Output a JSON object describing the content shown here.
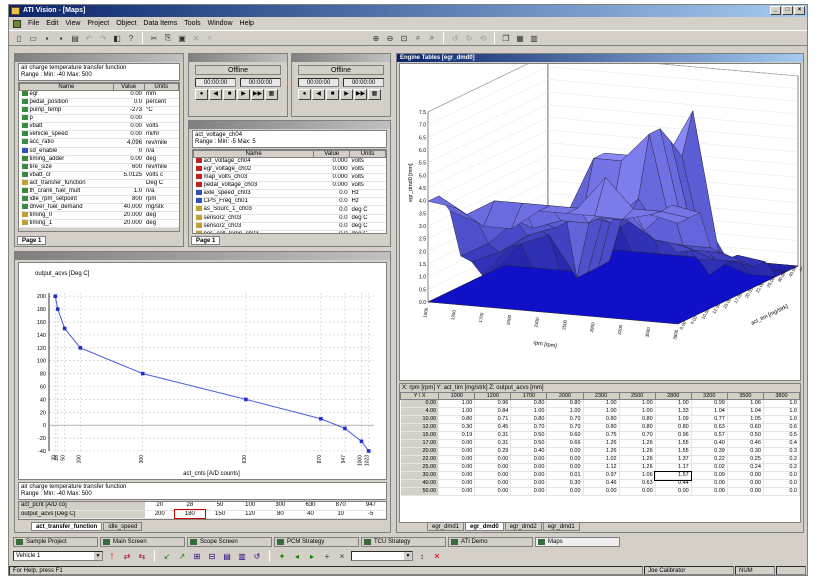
{
  "app": {
    "title": "ATI Vision - [Maps]"
  },
  "menu": [
    "File",
    "Edit",
    "View",
    "Project",
    "Object",
    "Data Items",
    "Tools",
    "Window",
    "Help"
  ],
  "toolbar": {
    "icons": [
      "new-icon",
      "open-icon",
      "save-icon",
      "save-all-icon",
      "print-icon",
      "cut-icon",
      "copy-icon",
      "paste-icon",
      "undo-icon",
      "redo-icon",
      "zoom-in-icon",
      "zoom-out-icon",
      "zoom-fit-icon",
      "zoom-window-icon",
      "rotate-icon",
      "settings-icon"
    ]
  },
  "charge_panel": {
    "function": "air charge temperature transfer function",
    "range": "Range : Min: -40  Max: 500",
    "headers": [
      "Name",
      "Value",
      "Units"
    ],
    "rows": [
      [
        "egr",
        "0.00",
        "mm"
      ],
      [
        "pedal_position",
        "0.0",
        "percent"
      ],
      [
        "pump_temp",
        "-273",
        "°C"
      ],
      [
        "p",
        "0.00",
        ""
      ],
      [
        "vbatt",
        "0.00",
        "volts"
      ],
      [
        "vehicle_speed",
        "0.00",
        "mi/hr"
      ],
      [
        "acc_ratio",
        "4,096",
        "rev/mile"
      ],
      [
        "sd_enable",
        "0",
        "n/a"
      ],
      [
        "timing_adder",
        "0.00",
        "deg"
      ],
      [
        "tire_size",
        "600",
        "rev/mile"
      ],
      [
        "vbatt_cr",
        "5.0125",
        "volts c"
      ],
      [
        "act_transfer_function",
        "",
        "Deg C"
      ],
      [
        "th_crank_fuel_mult",
        "1.0",
        "n/a"
      ],
      [
        "idle_rpm_setpoint",
        "800",
        "rpm"
      ],
      [
        "driver_fuel_demand",
        "40,000",
        "mg/stk"
      ],
      [
        "timing_0",
        "20.000",
        "deg"
      ],
      [
        "timing_1",
        "20.000",
        "deg"
      ]
    ],
    "tab": "Page 1"
  },
  "timer_panel_1": {
    "status": "Offline",
    "t1": "00:00:00",
    "t2": "00:00:00"
  },
  "timer_panel_2": {
    "status": "Offline",
    "t1": "00:00:00",
    "t2": "00:00:00"
  },
  "voltage_panel": {
    "function": "act_voltage_ch04",
    "range": "Range : Min: -5  Max: 5",
    "headers": [
      "Name",
      "Value",
      "Units"
    ],
    "rows": [
      [
        "act_voltage_ch04",
        "0.000",
        "volts"
      ],
      [
        "egr_voltage_ch02",
        "0.000",
        "volts"
      ],
      [
        "map_volts_ch03",
        "0.000",
        "volts"
      ],
      [
        "pedal_voltage_ch03",
        "0.000",
        "volts"
      ],
      [
        "axle_speed_ch03",
        "0.0",
        "Hz"
      ],
      [
        "CPS_Freq_ch01",
        "0.0",
        "Hz"
      ],
      [
        "as_Sourc_1_ch03",
        "0.0",
        "deg C"
      ],
      [
        "sensor2_ch03",
        "0.0",
        "deg C"
      ],
      [
        "sensor2_ch03",
        "0.0",
        "deg C"
      ],
      [
        "pos_cell_temp_ch03",
        "0.0",
        "deg C"
      ]
    ],
    "tab": "Page 1"
  },
  "curve_panel": {
    "chart_data": {
      "type": "line",
      "title": "output_acvs [Deg C]",
      "xlabel": "act_cnts [A/D counts]",
      "ylabel": "",
      "x": [
        20,
        28,
        50,
        100,
        300,
        630,
        870,
        947,
        1000,
        1023
      ],
      "y": [
        200,
        180,
        150,
        120,
        80,
        40,
        10,
        -5,
        -25,
        -40
      ],
      "yticks": [
        200,
        180,
        160,
        140,
        120,
        100,
        80,
        60,
        40,
        20,
        0,
        -20,
        -40
      ],
      "xticks": [
        "20",
        "28",
        "50",
        "100",
        "300",
        "630",
        "870",
        "947",
        "1000",
        "1023"
      ],
      "xlim": [
        0,
        1040
      ],
      "ylim": [
        -40,
        205
      ],
      "grid": true
    },
    "info_function": "air charge temperature transfer function",
    "info_range": "Range : Min: -40  Max: 500",
    "row_labels": [
      "act_pcnt [A/D co]",
      "output_acvs [Deg C]"
    ],
    "row1": [
      "20",
      "28",
      "50",
      "100",
      "300",
      "630",
      "870",
      "947"
    ],
    "row2": [
      "200",
      "180",
      "150",
      "120",
      "80",
      "40",
      "10",
      "-5"
    ],
    "tabs": [
      "act_transfer_function",
      "idle_speed"
    ]
  },
  "engine_panel": {
    "title": "Engine Tables [egr_dmd0]",
    "z_ticks": [
      "7.5",
      "7.0",
      "6.5",
      "6.0",
      "5.5",
      "5.0",
      "4.5",
      "4.0",
      "3.5",
      "3.0",
      "2.5",
      "2.0",
      "1.5",
      "1.0",
      "0.5",
      "0.0"
    ],
    "z_label": "egr_dmd0 [mm]",
    "x_label": "rpm [rpm]",
    "y_label": "act_tim [mg/strk]",
    "axis_top_left": "act_tim [mg/strk]",
    "axis_top_right": "rpm [rpm]",
    "table_header": "X: rpm [rpm]    Y: act_tim [mg/strk]    Z: output_acvs [mm]",
    "cols": [
      "Y \\ X",
      "1000",
      "1200",
      "1700",
      "2000",
      "2300",
      "2500",
      "2800",
      "3200",
      "3500",
      "3800"
    ],
    "rows": [
      [
        "0.00",
        "1.00",
        "0.96",
        "0.80",
        "0.80",
        "1.00",
        "1.00",
        "1.00",
        "0.99",
        "1.06",
        "1.0"
      ],
      [
        "4.00",
        "1.00",
        "0.84",
        "1.00",
        "1.00",
        "1.00",
        "1.00",
        "1.33",
        "1.04",
        "1.04",
        "1.0"
      ],
      [
        "10.00",
        "0.80",
        "0.71",
        "0.80",
        "0.70",
        "0.80",
        "0.80",
        "1.09",
        "0.77",
        "1.05",
        "1.0"
      ],
      [
        "12.00",
        "0.30",
        "0.45",
        "0.70",
        "0.70",
        "0.80",
        "0.80",
        "0.80",
        "0.63",
        "0.60",
        "0.6"
      ],
      [
        "15.00",
        "0.19",
        "0.31",
        "0.50",
        "0.60",
        "0.75",
        "0.70",
        "0.96",
        "0.57",
        "0.50",
        "0.5"
      ],
      [
        "17.00",
        "0.00",
        "0.31",
        "0.50",
        "0.66",
        "1.26",
        "1.26",
        "1.55",
        "0.40",
        "0.46",
        "0.4"
      ],
      [
        "20.00",
        "0.00",
        "0.29",
        "0.40",
        "0.00",
        "1.26",
        "1.26",
        "1.55",
        "0.39",
        "0.30",
        "0.3"
      ],
      [
        "22.00",
        "0.00",
        "0.00",
        "0.00",
        "0.00",
        "1.02",
        "1.26",
        "1.37",
        "0.22",
        "0.25",
        "0.2"
      ],
      [
        "25.00",
        "0.00",
        "0.00",
        "0.00",
        "0.00",
        "1.12",
        "1.26",
        "1.17",
        "0.02",
        "0.24",
        "0.2"
      ],
      [
        "30.00",
        "0.00",
        "0.00",
        "0.00",
        "0.01",
        "0.97",
        "1.06",
        "1.57",
        "0.09",
        "0.00",
        "0.0"
      ],
      [
        "40.00",
        "0.00",
        "0.00",
        "0.00",
        "0.30",
        "0.46",
        "0.63",
        "0.44",
        "0.00",
        "0.00",
        "0.0"
      ],
      [
        "50.00",
        "0.00",
        "0.00",
        "0.00",
        "0.00",
        "0.00",
        "0.00",
        "0.00",
        "0.00",
        "0.00",
        "0.0"
      ]
    ],
    "tabs": [
      "egr_dmd1",
      "egr_dmd0",
      "egr_dmd2",
      "egr_dmd1"
    ]
  },
  "tasks": [
    "Sample Project",
    "Main Screen",
    "Scope Screen",
    "PCM Strategy",
    "TCU Strategy",
    "ATI Demo",
    "Maps"
  ],
  "bottom": {
    "vehicle": "Vehicle 1"
  },
  "status": {
    "help": "For Help, press F1",
    "user": "Joe Calibrator",
    "num": "NUM"
  }
}
